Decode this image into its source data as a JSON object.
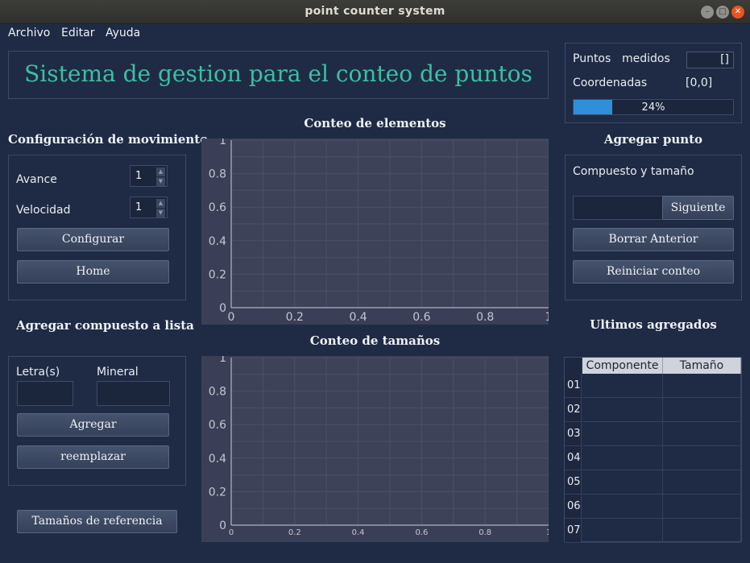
{
  "window": {
    "title": "point counter system"
  },
  "menu": [
    "Archivo",
    "Editar",
    "Ayuda"
  ],
  "header": {
    "title": "Sistema de gestion para el conteo de puntos"
  },
  "status": {
    "points_label": "Puntos",
    "measured_label": "medidos",
    "points_value": "[]",
    "coords_label": "Coordenadas",
    "coords_value": "[0,0]",
    "progress_percent": 24,
    "progress_text": "24%"
  },
  "movement": {
    "title": "Configuración de movimiento",
    "advance_label": "Avance",
    "advance_value": "1",
    "speed_label": "Velocidad",
    "speed_value": "1",
    "configure_button": "Configurar",
    "home_button": "Home"
  },
  "add_compound": {
    "title": "Agregar compuesto a lista",
    "letters_label": "Letra(s)",
    "mineral_label": "Mineral",
    "add_button": "Agregar",
    "replace_button": "reemplazar"
  },
  "reference_button": "Tamaños de referencia",
  "add_point": {
    "title": "Agregar punto",
    "compound_label": "Compuesto y tamaño",
    "next_button": "Siguiente",
    "delete_button": "Borrar Anterior",
    "reset_button": "Reiniciar conteo"
  },
  "latest": {
    "title": "Ultimos  agregados",
    "columns": [
      "Componente",
      "Tamaño"
    ],
    "rows": [
      "01",
      "02",
      "03",
      "04",
      "05",
      "06",
      "07"
    ]
  },
  "chart_data": [
    {
      "type": "bar",
      "title": "Conteo de elementos",
      "xlim": [
        0,
        1
      ],
      "ylim": [
        0,
        1
      ],
      "x_ticks": [
        "0",
        "0.2",
        "0.4",
        "0.6",
        "0.8",
        "1"
      ],
      "y_ticks": [
        "0",
        "0.2",
        "0.4",
        "0.6",
        "0.8",
        "1"
      ],
      "grid": true,
      "values": []
    },
    {
      "type": "bar",
      "title": "Conteo de tamaños",
      "xlim": [
        0,
        1
      ],
      "ylim": [
        0,
        1
      ],
      "x_ticks": [
        "0",
        "0.2",
        "0.4",
        "0.6",
        "0.8",
        "1"
      ],
      "y_ticks": [
        "0",
        "0.2",
        "0.4",
        "0.6",
        "0.8",
        "1"
      ],
      "grid": true,
      "values": []
    }
  ],
  "colors": {
    "background": "#1f2b45",
    "title_accent": "#3cbfa3",
    "progress": "#2f8fd8"
  }
}
